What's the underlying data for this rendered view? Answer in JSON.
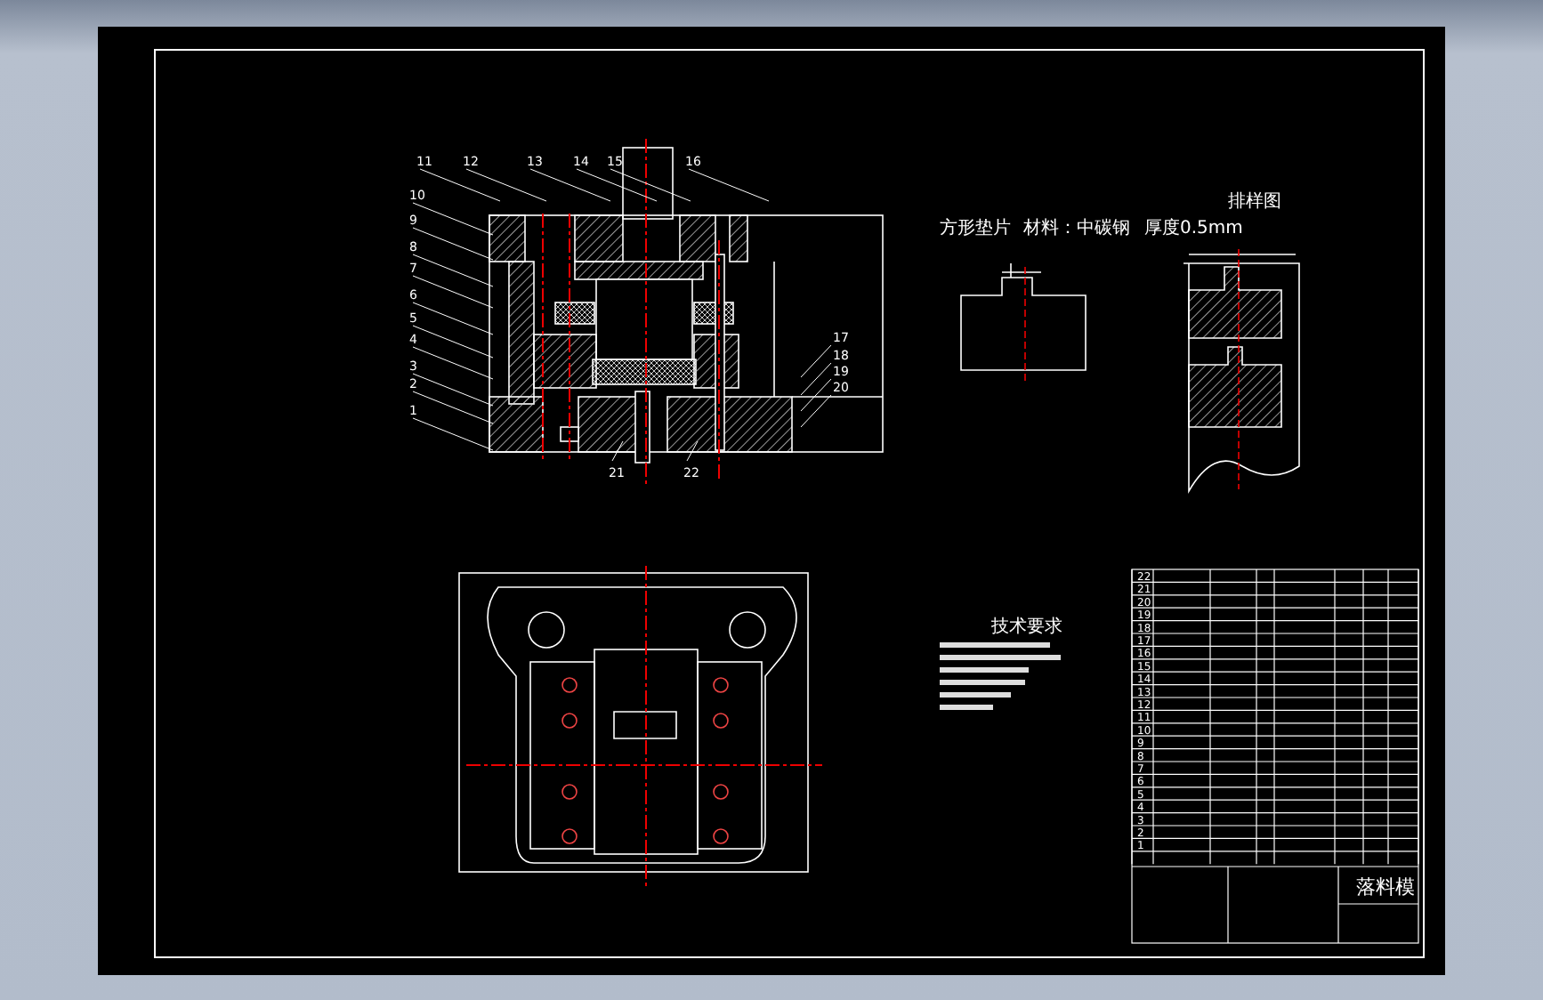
{
  "part_header": {
    "part": "方形垫片",
    "material": "材料：中碳钢",
    "thickness": "厚度0.5mm"
  },
  "layout_title": "排样图",
  "notes_title": "技术要求",
  "balloons": [
    "11",
    "12",
    "13",
    "14",
    "15",
    "16",
    "10",
    "9",
    "8",
    "7",
    "6",
    "5",
    "4",
    "3",
    "2",
    "1",
    "17",
    "18",
    "19",
    "20",
    "21",
    "22"
  ],
  "parts_list": {
    "numbers": [
      "22",
      "21",
      "20",
      "19",
      "18",
      "17",
      "16",
      "15",
      "14",
      "13",
      "12",
      "11",
      "10",
      "9",
      "8",
      "7",
      "6",
      "5",
      "4",
      "3",
      "2",
      "1"
    ]
  },
  "title_block": {
    "title": "落料模"
  }
}
